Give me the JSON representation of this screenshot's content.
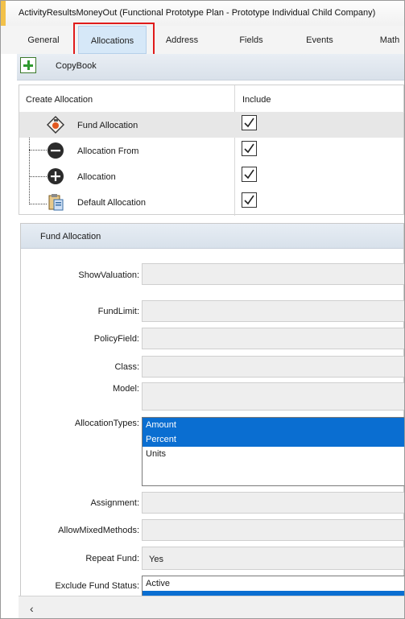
{
  "window": {
    "title": "ActivityResultsMoneyOut (Functional Prototype Plan - Prototype Individual Child Company)"
  },
  "tabs": [
    {
      "label": "General"
    },
    {
      "label": "Allocations",
      "active": true
    },
    {
      "label": "Address"
    },
    {
      "label": "Fields"
    },
    {
      "label": "Events"
    },
    {
      "label": "Math"
    }
  ],
  "toolbar": {
    "add_icon": "add-icon",
    "label": "CopyBook"
  },
  "grid": {
    "col_name": "Create Allocation",
    "col_include": "Include",
    "rows": [
      {
        "name": "Fund Allocation",
        "icon": "fund-allocation-icon",
        "include": true,
        "selected": true
      },
      {
        "name": "Allocation From",
        "icon": "minus-circle-icon",
        "include": true
      },
      {
        "name": "Allocation",
        "icon": "plus-circle-icon",
        "include": true
      },
      {
        "name": "Default Allocation",
        "icon": "clipboard-icon",
        "include": true
      }
    ]
  },
  "panel": {
    "title": "Fund Allocation",
    "fields": {
      "show_valuation": "ShowValuation:",
      "fund_limit": "FundLimit:",
      "policy_field": "PolicyField:",
      "class": "Class:",
      "model": "Model:",
      "allocation_types": "AllocationTypes:",
      "assignment": "Assignment:",
      "allow_mixed_methods": "AllowMixedMethods:",
      "repeat_fund": "Repeat Fund:",
      "exclude_fund_status": "Exclude Fund Status:"
    },
    "allocation_types_options": [
      {
        "label": "Amount",
        "selected": true
      },
      {
        "label": "Percent",
        "selected": true
      },
      {
        "label": "Units",
        "selected": false
      }
    ],
    "repeat_fund_value": "Yes",
    "exclude_fund_status_options": [
      {
        "label": "Active",
        "selected": false
      }
    ]
  },
  "scrollbar": {
    "left_arrow": "‹"
  }
}
